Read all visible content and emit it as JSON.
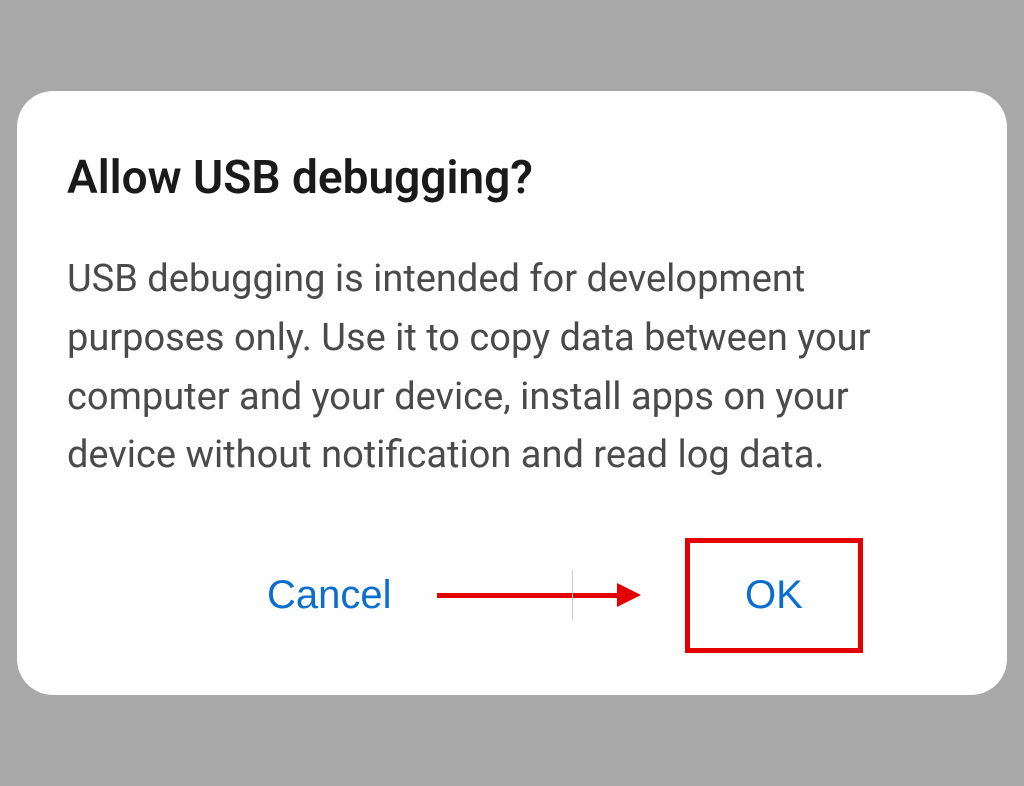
{
  "dialog": {
    "title": "Allow USB debugging?",
    "body": "USB debugging is intended for development purposes only. Use it to copy data between your computer and your device, install apps on your device without notification and read log data.",
    "cancel_label": "Cancel",
    "ok_label": "OK"
  },
  "annotation": {
    "highlight_color": "#e30000",
    "button_accent": "#0a6ed1"
  }
}
